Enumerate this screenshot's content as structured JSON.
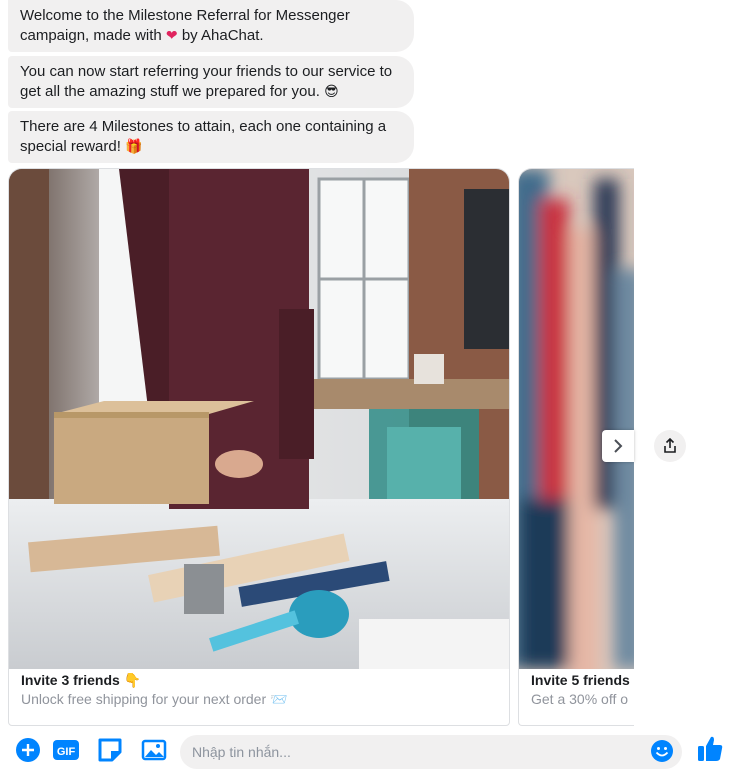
{
  "messages": [
    {
      "text": "Welcome to the Milestone Referral for Messenger campaign, made with",
      "emoji": "❤",
      "suffix": "by AhaChat."
    },
    {
      "text": "You can now start referring your friends to our service to get all the amazing stuff we prepared for you.",
      "emoji": "😎"
    },
    {
      "text": "There are 4 Milestones to attain, each one containing a special reward!",
      "emoji": "🎁"
    }
  ],
  "cards": [
    {
      "title": "Invite 3 friends",
      "title_emoji": "👇",
      "subtitle": "Unlock free shipping for your next order",
      "subtitle_emoji": "📨"
    },
    {
      "title": "Invite 5 friends",
      "subtitle": "Get a 30% off o"
    }
  ],
  "composer": {
    "placeholder": "Nhập tin nhắn..."
  },
  "icons": {
    "add": "plus-circle-icon",
    "gif": "gif-icon",
    "sticker": "sticker-icon",
    "image": "image-icon",
    "emoji": "smiley-icon",
    "like": "thumbs-up-icon",
    "next": "chevron-right-icon",
    "share": "share-icon"
  },
  "colors": {
    "accent": "#0084ff",
    "bubble": "#f1f0f0",
    "subtitle": "#90949c"
  }
}
